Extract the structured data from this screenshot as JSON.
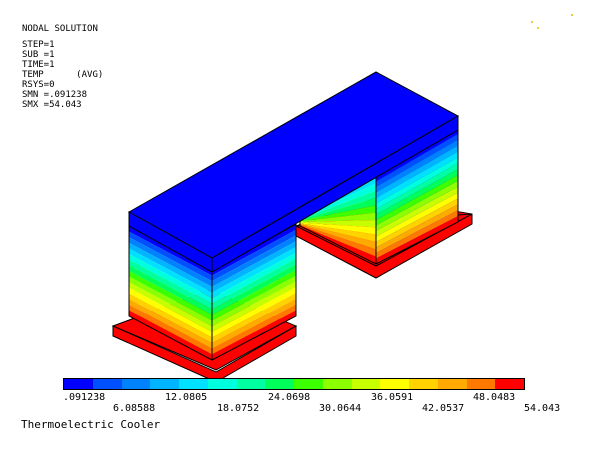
{
  "header": {
    "title": "NODAL SOLUTION",
    "lines": [
      "STEP=1",
      "SUB =1",
      "TIME=1",
      "TEMP      (AVG)",
      "RSYS=0",
      "SMN =.091238",
      "SMX =54.043"
    ]
  },
  "legend": {
    "colors": [
      "#0000ff",
      "#0050ff",
      "#0082ff",
      "#00b4ff",
      "#00e1ff",
      "#00ffdc",
      "#00ffa0",
      "#00ff5a",
      "#3cff00",
      "#8cff00",
      "#c8ff00",
      "#ffff00",
      "#ffd200",
      "#ffaa00",
      "#ff7800",
      "#ff0000"
    ],
    "labels_top": [
      ".091238",
      "12.0805",
      "24.0698",
      "36.0591",
      "48.0483"
    ],
    "labels_bottom": [
      "6.08588",
      "18.0752",
      "30.0644",
      "42.0537",
      "54.043"
    ]
  },
  "caption": "Thermoelectric Cooler",
  "scene_colors": {
    "top_face": "#0000ff",
    "edge": "#000000",
    "hot": "#ff0000",
    "dark_side": "#000060"
  }
}
